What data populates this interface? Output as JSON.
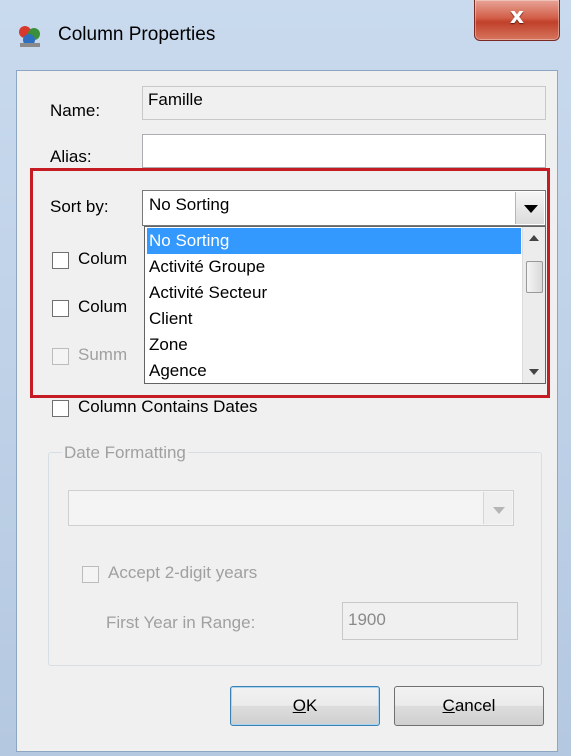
{
  "window": {
    "title": "Column Properties",
    "close_glyph": "x"
  },
  "name_field": {
    "label": "Name:",
    "value": "Famille"
  },
  "alias_field": {
    "label": "Alias:",
    "value": ""
  },
  "sort_by": {
    "label": "Sort by:",
    "value": "No Sorting",
    "options": [
      "No Sorting",
      "Activité Groupe",
      "Activité Secteur",
      "Client",
      "Zone",
      "Agence"
    ],
    "selected_index": 0
  },
  "checkboxes": {
    "col1_partial": "Colum",
    "col2_partial": "Colum",
    "summ_partial": "Summ",
    "contains_dates": "Column Contains Dates"
  },
  "date_formatting": {
    "group_title": "Date Formatting",
    "format_value": "",
    "accept_2digit": "Accept 2-digit years",
    "first_year_label": "First Year in Range:",
    "first_year_value": "1900"
  },
  "buttons": {
    "ok_mnemonic": "O",
    "ok_rest": "K",
    "cancel_mnemonic": "C",
    "cancel_rest": "ancel"
  },
  "colors": {
    "highlight": "#c51c24",
    "selection": "#3399ff"
  }
}
